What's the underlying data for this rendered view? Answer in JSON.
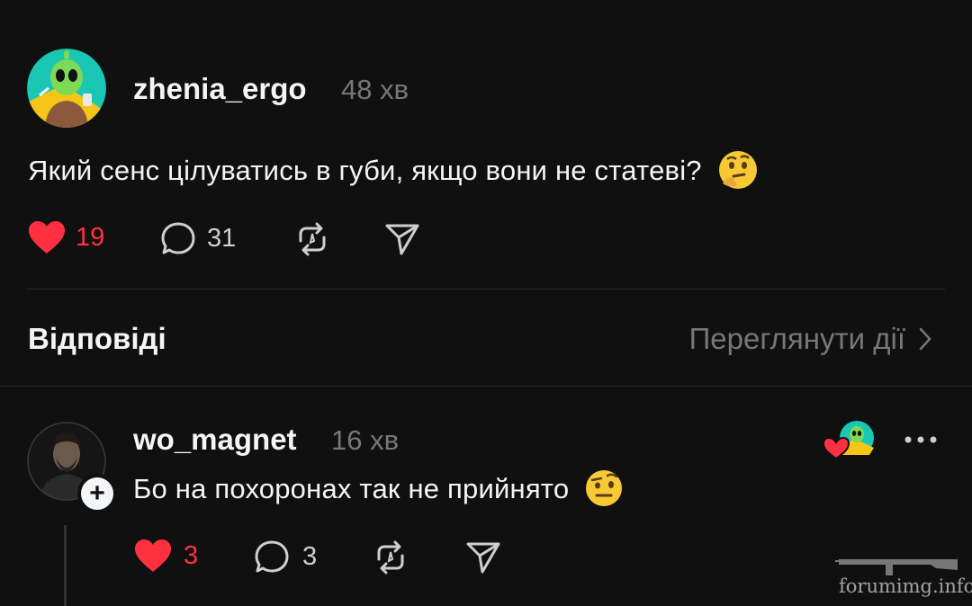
{
  "post": {
    "username": "zhenia_ergo",
    "time": "48 хв",
    "text": "Який сенс цілуватись в губи, якщо вони не статеві?",
    "emoji": "thinking-face-emoji",
    "likes": "19",
    "comments": "31"
  },
  "replies_section": {
    "title": "Відповіді",
    "view_activity": "Переглянути дії"
  },
  "reply": {
    "username": "wo_magnet",
    "time": "16 хв",
    "text": "Бо на похоронах так не прийнято",
    "emoji": "raised-eyebrow-emoji",
    "likes": "3",
    "comments": "3",
    "follow_badge": "+"
  },
  "watermark": "forumimg.info",
  "colors": {
    "background": "#101010",
    "like_red": "#ff3040",
    "muted": "#777777",
    "avatar_teal": "#19c7b4",
    "avatar_yellow": "#f5c518"
  }
}
